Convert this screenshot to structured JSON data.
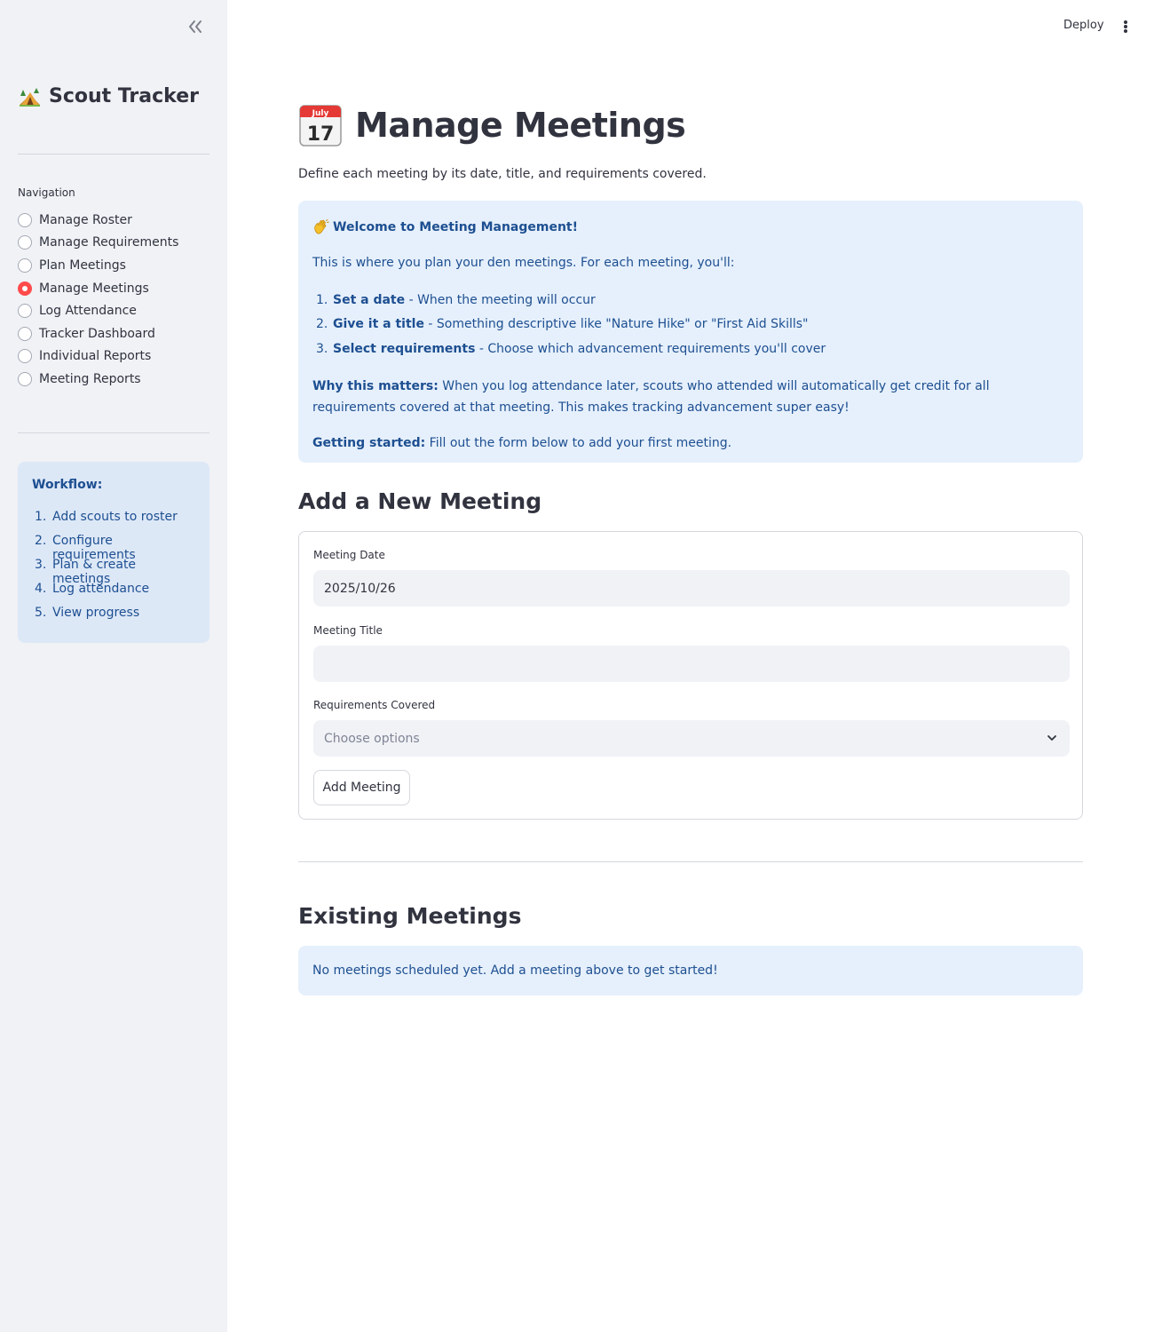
{
  "header": {
    "deploy_label": "Deploy",
    "menu_icon": "more-vertical-icon"
  },
  "sidebar": {
    "collapse_icon": "double-chevron-left-icon",
    "app_title": "Scout Tracker",
    "app_icon": "camping-tent-icon",
    "nav_label": "Navigation",
    "nav_items": [
      {
        "label": "Manage Roster",
        "selected": false
      },
      {
        "label": "Manage Requirements",
        "selected": false
      },
      {
        "label": "Plan Meetings",
        "selected": false
      },
      {
        "label": "Manage Meetings",
        "selected": true
      },
      {
        "label": "Log Attendance",
        "selected": false
      },
      {
        "label": "Tracker Dashboard",
        "selected": false
      },
      {
        "label": "Individual Reports",
        "selected": false
      },
      {
        "label": "Meeting Reports",
        "selected": false
      }
    ],
    "workflow": {
      "title": "Workflow:",
      "steps": [
        {
          "num": "1.",
          "text": "Add scouts to roster"
        },
        {
          "num": "2.",
          "text": "Configure requirements"
        },
        {
          "num": "3.",
          "text": "Plan & create meetings"
        },
        {
          "num": "4.",
          "text": "Log attendance"
        },
        {
          "num": "5.",
          "text": "View progress"
        }
      ]
    }
  },
  "main": {
    "title": "Manage Meetings",
    "title_icon": "calendar-july-17-icon",
    "subtitle": "Define each meeting by its date, title, and requirements covered.",
    "info": {
      "welcome_icon": "waving-hand-icon",
      "welcome": "Welcome to Meeting Management!",
      "intro": "This is where you plan your den meetings. For each meeting, you'll:",
      "steps": [
        {
          "num": "1.",
          "bold": "Set a date",
          "text": " - When the meeting will occur"
        },
        {
          "num": "2.",
          "bold": "Give it a title",
          "text": " - Something descriptive like \"Nature Hike\" or \"First Aid Skills\""
        },
        {
          "num": "3.",
          "bold": "Select requirements",
          "text": " - Choose which advancement requirements you'll cover"
        }
      ],
      "why_bold": "Why this matters:",
      "why_text": " When you log attendance later, scouts who attended will automatically get credit for all requirements covered at that meeting. This makes tracking advancement super easy!",
      "start_bold": "Getting started:",
      "start_text": " Fill out the form below to add your first meeting."
    },
    "add_section": {
      "heading": "Add a New Meeting",
      "date_label": "Meeting Date",
      "date_value": "2025/10/26",
      "title_label": "Meeting Title",
      "title_value": "",
      "req_label": "Requirements Covered",
      "req_placeholder": "Choose options",
      "button_label": "Add Meeting"
    },
    "existing_section": {
      "heading": "Existing Meetings",
      "empty_message": "No meetings scheduled yet. Add a meeting above to get started!"
    }
  }
}
